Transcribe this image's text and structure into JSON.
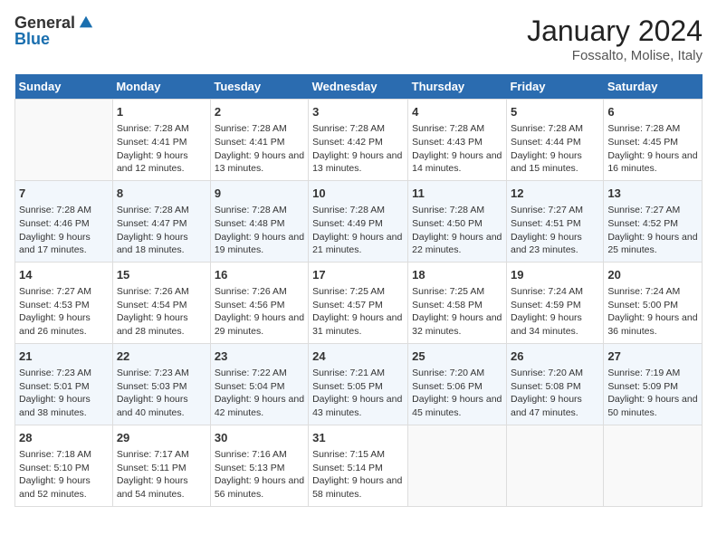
{
  "header": {
    "logo_general": "General",
    "logo_blue": "Blue",
    "month": "January 2024",
    "location": "Fossalto, Molise, Italy"
  },
  "days": [
    "Sunday",
    "Monday",
    "Tuesday",
    "Wednesday",
    "Thursday",
    "Friday",
    "Saturday"
  ],
  "weeks": [
    [
      {
        "date": "",
        "sunrise": "",
        "sunset": "",
        "daylight": ""
      },
      {
        "date": "1",
        "sunrise": "Sunrise: 7:28 AM",
        "sunset": "Sunset: 4:41 PM",
        "daylight": "Daylight: 9 hours and 12 minutes."
      },
      {
        "date": "2",
        "sunrise": "Sunrise: 7:28 AM",
        "sunset": "Sunset: 4:41 PM",
        "daylight": "Daylight: 9 hours and 13 minutes."
      },
      {
        "date": "3",
        "sunrise": "Sunrise: 7:28 AM",
        "sunset": "Sunset: 4:42 PM",
        "daylight": "Daylight: 9 hours and 13 minutes."
      },
      {
        "date": "4",
        "sunrise": "Sunrise: 7:28 AM",
        "sunset": "Sunset: 4:43 PM",
        "daylight": "Daylight: 9 hours and 14 minutes."
      },
      {
        "date": "5",
        "sunrise": "Sunrise: 7:28 AM",
        "sunset": "Sunset: 4:44 PM",
        "daylight": "Daylight: 9 hours and 15 minutes."
      },
      {
        "date": "6",
        "sunrise": "Sunrise: 7:28 AM",
        "sunset": "Sunset: 4:45 PM",
        "daylight": "Daylight: 9 hours and 16 minutes."
      }
    ],
    [
      {
        "date": "7",
        "sunrise": "Sunrise: 7:28 AM",
        "sunset": "Sunset: 4:46 PM",
        "daylight": "Daylight: 9 hours and 17 minutes."
      },
      {
        "date": "8",
        "sunrise": "Sunrise: 7:28 AM",
        "sunset": "Sunset: 4:47 PM",
        "daylight": "Daylight: 9 hours and 18 minutes."
      },
      {
        "date": "9",
        "sunrise": "Sunrise: 7:28 AM",
        "sunset": "Sunset: 4:48 PM",
        "daylight": "Daylight: 9 hours and 19 minutes."
      },
      {
        "date": "10",
        "sunrise": "Sunrise: 7:28 AM",
        "sunset": "Sunset: 4:49 PM",
        "daylight": "Daylight: 9 hours and 21 minutes."
      },
      {
        "date": "11",
        "sunrise": "Sunrise: 7:28 AM",
        "sunset": "Sunset: 4:50 PM",
        "daylight": "Daylight: 9 hours and 22 minutes."
      },
      {
        "date": "12",
        "sunrise": "Sunrise: 7:27 AM",
        "sunset": "Sunset: 4:51 PM",
        "daylight": "Daylight: 9 hours and 23 minutes."
      },
      {
        "date": "13",
        "sunrise": "Sunrise: 7:27 AM",
        "sunset": "Sunset: 4:52 PM",
        "daylight": "Daylight: 9 hours and 25 minutes."
      }
    ],
    [
      {
        "date": "14",
        "sunrise": "Sunrise: 7:27 AM",
        "sunset": "Sunset: 4:53 PM",
        "daylight": "Daylight: 9 hours and 26 minutes."
      },
      {
        "date": "15",
        "sunrise": "Sunrise: 7:26 AM",
        "sunset": "Sunset: 4:54 PM",
        "daylight": "Daylight: 9 hours and 28 minutes."
      },
      {
        "date": "16",
        "sunrise": "Sunrise: 7:26 AM",
        "sunset": "Sunset: 4:56 PM",
        "daylight": "Daylight: 9 hours and 29 minutes."
      },
      {
        "date": "17",
        "sunrise": "Sunrise: 7:25 AM",
        "sunset": "Sunset: 4:57 PM",
        "daylight": "Daylight: 9 hours and 31 minutes."
      },
      {
        "date": "18",
        "sunrise": "Sunrise: 7:25 AM",
        "sunset": "Sunset: 4:58 PM",
        "daylight": "Daylight: 9 hours and 32 minutes."
      },
      {
        "date": "19",
        "sunrise": "Sunrise: 7:24 AM",
        "sunset": "Sunset: 4:59 PM",
        "daylight": "Daylight: 9 hours and 34 minutes."
      },
      {
        "date": "20",
        "sunrise": "Sunrise: 7:24 AM",
        "sunset": "Sunset: 5:00 PM",
        "daylight": "Daylight: 9 hours and 36 minutes."
      }
    ],
    [
      {
        "date": "21",
        "sunrise": "Sunrise: 7:23 AM",
        "sunset": "Sunset: 5:01 PM",
        "daylight": "Daylight: 9 hours and 38 minutes."
      },
      {
        "date": "22",
        "sunrise": "Sunrise: 7:23 AM",
        "sunset": "Sunset: 5:03 PM",
        "daylight": "Daylight: 9 hours and 40 minutes."
      },
      {
        "date": "23",
        "sunrise": "Sunrise: 7:22 AM",
        "sunset": "Sunset: 5:04 PM",
        "daylight": "Daylight: 9 hours and 42 minutes."
      },
      {
        "date": "24",
        "sunrise": "Sunrise: 7:21 AM",
        "sunset": "Sunset: 5:05 PM",
        "daylight": "Daylight: 9 hours and 43 minutes."
      },
      {
        "date": "25",
        "sunrise": "Sunrise: 7:20 AM",
        "sunset": "Sunset: 5:06 PM",
        "daylight": "Daylight: 9 hours and 45 minutes."
      },
      {
        "date": "26",
        "sunrise": "Sunrise: 7:20 AM",
        "sunset": "Sunset: 5:08 PM",
        "daylight": "Daylight: 9 hours and 47 minutes."
      },
      {
        "date": "27",
        "sunrise": "Sunrise: 7:19 AM",
        "sunset": "Sunset: 5:09 PM",
        "daylight": "Daylight: 9 hours and 50 minutes."
      }
    ],
    [
      {
        "date": "28",
        "sunrise": "Sunrise: 7:18 AM",
        "sunset": "Sunset: 5:10 PM",
        "daylight": "Daylight: 9 hours and 52 minutes."
      },
      {
        "date": "29",
        "sunrise": "Sunrise: 7:17 AM",
        "sunset": "Sunset: 5:11 PM",
        "daylight": "Daylight: 9 hours and 54 minutes."
      },
      {
        "date": "30",
        "sunrise": "Sunrise: 7:16 AM",
        "sunset": "Sunset: 5:13 PM",
        "daylight": "Daylight: 9 hours and 56 minutes."
      },
      {
        "date": "31",
        "sunrise": "Sunrise: 7:15 AM",
        "sunset": "Sunset: 5:14 PM",
        "daylight": "Daylight: 9 hours and 58 minutes."
      },
      {
        "date": "",
        "sunrise": "",
        "sunset": "",
        "daylight": ""
      },
      {
        "date": "",
        "sunrise": "",
        "sunset": "",
        "daylight": ""
      },
      {
        "date": "",
        "sunrise": "",
        "sunset": "",
        "daylight": ""
      }
    ]
  ]
}
